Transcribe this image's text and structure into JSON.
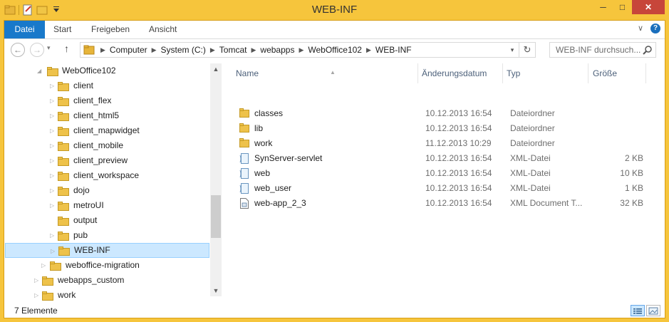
{
  "window": {
    "title": "WEB-INF",
    "minimize": "─",
    "maximize": "□",
    "close": "✕"
  },
  "ribbon": {
    "tabs": [
      {
        "label": "Datei"
      },
      {
        "label": "Start"
      },
      {
        "label": "Freigeben"
      },
      {
        "label": "Ansicht"
      }
    ],
    "collapse_glyph": "∨",
    "help_glyph": "?"
  },
  "nav": {
    "back": "←",
    "forward": "→",
    "recent": "▾",
    "up": "↑",
    "breadcrumbs": [
      "Computer",
      "System (C:)",
      "Tomcat",
      "webapps",
      "WebOffice102",
      "WEB-INF"
    ],
    "crumb_separator": "▶",
    "dropdown": "▾",
    "refresh": "↻"
  },
  "search": {
    "placeholder": "WEB-INF durchsuch..."
  },
  "tree": {
    "items": [
      {
        "label": "WebOffice102",
        "expanded": true
      },
      {
        "label": "client"
      },
      {
        "label": "client_flex"
      },
      {
        "label": "client_html5"
      },
      {
        "label": "client_mapwidget"
      },
      {
        "label": "client_mobile"
      },
      {
        "label": "client_preview"
      },
      {
        "label": "client_workspace"
      },
      {
        "label": "dojo"
      },
      {
        "label": "metroUI"
      },
      {
        "label": "output"
      },
      {
        "label": "pub"
      },
      {
        "label": "WEB-INF",
        "selected": true
      },
      {
        "label": "weboffice-migration"
      },
      {
        "label": "webapps_custom"
      },
      {
        "label": "work"
      }
    ]
  },
  "list": {
    "columns": {
      "name": "Name",
      "date": "Änderungsdatum",
      "type": "Typ",
      "size": "Größe"
    },
    "rows": [
      {
        "name": "classes",
        "date": "10.12.2013 16:54",
        "type": "Dateiordner",
        "size": "",
        "icon": "folder"
      },
      {
        "name": "lib",
        "date": "10.12.2013 16:54",
        "type": "Dateiordner",
        "size": "",
        "icon": "folder"
      },
      {
        "name": "work",
        "date": "11.12.2013 10:29",
        "type": "Dateiordner",
        "size": "",
        "icon": "folder"
      },
      {
        "name": "SynServer-servlet",
        "date": "10.12.2013 16:54",
        "type": "XML-Datei",
        "size": "2 KB",
        "icon": "xml"
      },
      {
        "name": "web",
        "date": "10.12.2013 16:54",
        "type": "XML-Datei",
        "size": "10 KB",
        "icon": "xml"
      },
      {
        "name": "web_user",
        "date": "10.12.2013 16:54",
        "type": "XML-Datei",
        "size": "1 KB",
        "icon": "xml"
      },
      {
        "name": "web-app_2_3",
        "date": "10.12.2013 16:54",
        "type": "XML Document T...",
        "size": "32 KB",
        "icon": "xmldoc"
      }
    ]
  },
  "status": {
    "count": "7 Elemente"
  },
  "colors": {
    "accent": "#1979ca",
    "frame": "#f6c53c",
    "close": "#c7463a",
    "selection": "#cce8ff",
    "folder": "#e8b838"
  }
}
